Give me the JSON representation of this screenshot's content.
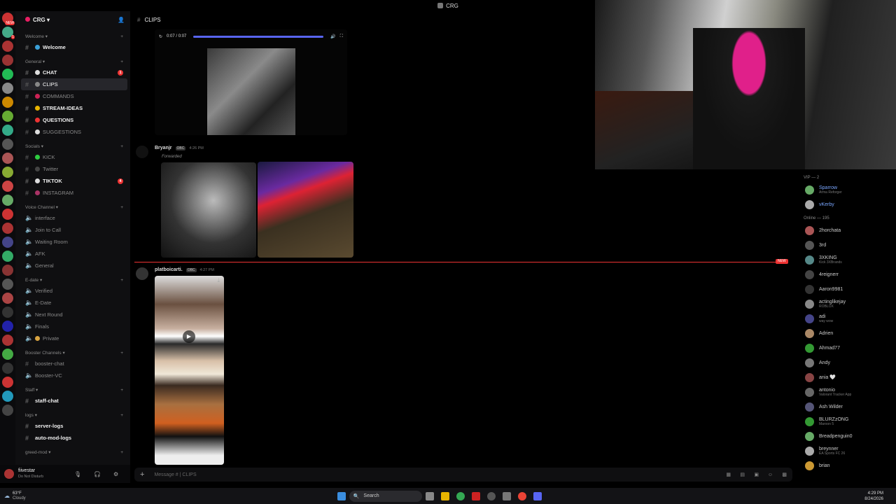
{
  "window_title": "CRG",
  "server": {
    "name": "CRG"
  },
  "server_rail_badges": [
    "NEW",
    "1",
    "",
    "",
    "",
    "",
    "",
    "",
    "",
    "",
    "",
    "",
    "",
    "",
    "",
    "",
    "",
    "",
    "",
    "",
    "",
    "",
    "",
    "",
    "",
    "",
    "",
    "",
    ""
  ],
  "channel_list": [
    {
      "type": "cat",
      "label": "Welcome"
    },
    {
      "type": "ch",
      "label": "Welcome",
      "unread": true,
      "dot": "#3aa0d8"
    },
    {
      "type": "cat",
      "label": "General"
    },
    {
      "type": "ch",
      "label": "CHAT",
      "unread": true,
      "badge": "1",
      "dot": "#ddd"
    },
    {
      "type": "ch",
      "label": "CLIPS",
      "active": true,
      "dot": "#888"
    },
    {
      "type": "ch",
      "label": "COMMANDS",
      "dot": "#c25"
    },
    {
      "type": "ch",
      "label": "STREAM-IDEAS",
      "unread": true,
      "dot": "#e8b400"
    },
    {
      "type": "ch",
      "label": "QUESTIONS",
      "unread": true,
      "dot": "#e33"
    },
    {
      "type": "ch",
      "label": "SUGGESTIONS",
      "dot": "#ddd"
    },
    {
      "type": "cat",
      "label": "Socials"
    },
    {
      "type": "ch",
      "label": "KICK",
      "dot": "#2ecc40"
    },
    {
      "type": "ch",
      "label": "Twitter",
      "dot": "#444"
    },
    {
      "type": "ch",
      "label": "TIKTOK",
      "unread": true,
      "badge": "4",
      "dot": "#ddd"
    },
    {
      "type": "ch",
      "label": "INSTAGRAM",
      "dot": "#a36"
    },
    {
      "type": "cat",
      "label": "Voice Channel"
    },
    {
      "type": "ch",
      "label": "interface",
      "voice": true
    },
    {
      "type": "ch",
      "label": "Join to Call",
      "voice": true
    },
    {
      "type": "ch",
      "label": "Waiting Room",
      "voice": true
    },
    {
      "type": "ch",
      "label": "AFK",
      "voice": true
    },
    {
      "type": "ch",
      "label": "General",
      "voice": true
    },
    {
      "type": "cat",
      "label": "E-date"
    },
    {
      "type": "ch",
      "label": "Verified",
      "voice": true
    },
    {
      "type": "ch",
      "label": "E-Date",
      "voice": true
    },
    {
      "type": "ch",
      "label": "Next Round",
      "voice": true
    },
    {
      "type": "ch",
      "label": "Finals",
      "voice": true
    },
    {
      "type": "ch",
      "label": "Private",
      "voice": true,
      "dot": "#d9a441"
    },
    {
      "type": "cat",
      "label": "Booster Channels"
    },
    {
      "type": "ch",
      "label": "booster-chat"
    },
    {
      "type": "ch",
      "label": "Booster-VC",
      "voice": true
    },
    {
      "type": "cat",
      "label": "Staff"
    },
    {
      "type": "ch",
      "label": "staff-chat",
      "unread": true
    },
    {
      "type": "cat",
      "label": "logs"
    },
    {
      "type": "ch",
      "label": "server-logs",
      "unread": true
    },
    {
      "type": "ch",
      "label": "auto-mod-logs",
      "unread": true
    },
    {
      "type": "cat",
      "label": "greed-mod"
    }
  ],
  "user_panel": {
    "name": "fiivestar",
    "status": "Do Not Disturb"
  },
  "chat": {
    "channel_name": "CLIPS",
    "video_time": "0:07 / 0:07",
    "messages": [
      {
        "user": "Bryanjr",
        "tag": "OBC",
        "time": "4:26 PM",
        "forwarded": "Forwarded"
      },
      {
        "user": "platboicarti.",
        "tag": "OBC",
        "time": "4:27 PM"
      }
    ],
    "new_label": "NEW",
    "composer_placeholder": "Message # | CLIPS"
  },
  "members": {
    "groups": [
      {
        "label": "VIP — 2",
        "items": [
          {
            "name": "Sparrow",
            "status": "Arma Reforger",
            "color": "#7aa7ff"
          },
          {
            "name": "vKerby",
            "status": "",
            "color": "#7aa7ff"
          }
        ]
      },
      {
        "label": "Online — 195",
        "items": [
          {
            "name": "2horchata",
            "status": ""
          },
          {
            "name": "3rd",
            "status": ""
          },
          {
            "name": "3XKING",
            "status": "Kick 3XBrands"
          },
          {
            "name": "4reignerr",
            "status": ""
          },
          {
            "name": "Aaron9981",
            "status": ""
          },
          {
            "name": "actinglikejay",
            "status": "ROBLOX"
          },
          {
            "name": "adi",
            "status": "way wow"
          },
          {
            "name": "Adrien",
            "status": ""
          },
          {
            "name": "Ahmad77",
            "status": ""
          },
          {
            "name": "Andy",
            "status": ""
          },
          {
            "name": "ania 🤍",
            "status": ""
          },
          {
            "name": "antonio",
            "status": "Valorant Tracker App"
          },
          {
            "name": "Ash Wilder",
            "status": ""
          },
          {
            "name": "BLURZzONG",
            "status": "Maroon 5"
          },
          {
            "name": "Breadpenguin0",
            "status": ""
          },
          {
            "name": "breynner",
            "status": "EA Sports FC 26"
          },
          {
            "name": "brian",
            "status": ""
          }
        ]
      }
    ]
  },
  "taskbar": {
    "weather_temp": "63°F",
    "weather_desc": "Cloudy",
    "search_label": "Search",
    "time": "4:29 PM",
    "date": "8/24/2026"
  },
  "colors": {
    "accent": "#5865f2",
    "danger": "#e33",
    "bg": "#000"
  }
}
